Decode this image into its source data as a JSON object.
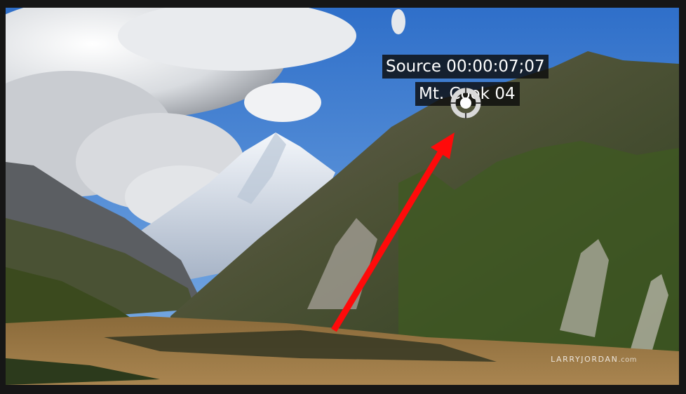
{
  "viewer": {
    "timecode_overlay": "Source 00:00:07;07",
    "clip_name_overlay": "Mt. Cook 04",
    "watermark_brand": "LARRYJORDAN",
    "watermark_suffix": ".com"
  },
  "icons": {
    "playhead_target": "crosshair-target-icon",
    "annotation_arrow": "red-arrow-icon"
  },
  "colors": {
    "arrow": "#ff0a0a",
    "overlay_bg": "#0c0c0c",
    "overlay_text": "#ffffff",
    "sky": "#3d7fd4"
  }
}
